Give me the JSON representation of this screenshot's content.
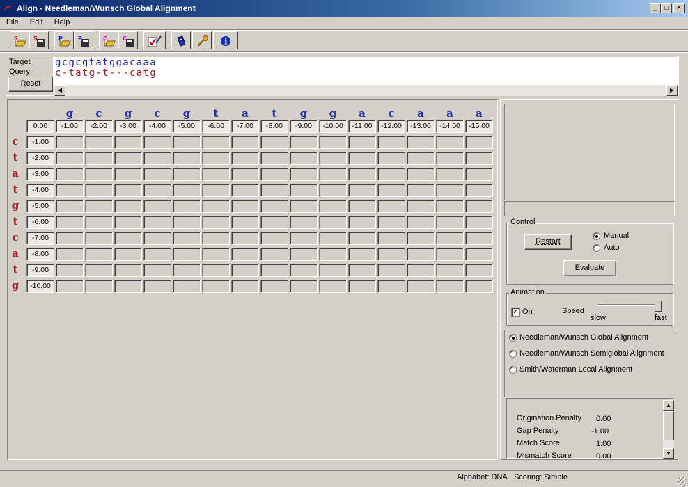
{
  "window": {
    "title": "Align - Needleman/Wunsch Global Alignment"
  },
  "menu": [
    "File",
    "Edit",
    "Help"
  ],
  "toolbar": [
    {
      "name": "open-sequence-s-icon"
    },
    {
      "name": "save-sequence-s-icon"
    },
    {
      "name": "open-project-p-icon"
    },
    {
      "name": "save-project-p-icon"
    },
    {
      "name": "open-config-c-icon"
    },
    {
      "name": "save-config-c-icon"
    },
    {
      "name": "edit-checklist-icon"
    },
    {
      "name": "book-icon"
    },
    {
      "name": "key-icon"
    },
    {
      "name": "info-icon"
    }
  ],
  "sequences": {
    "target_label": "Target",
    "query_label": "Query",
    "reset_label": "Reset",
    "target": "gcgcgtatggacaaa",
    "query": "c-tatg-t---catg"
  },
  "matrix": {
    "col_letters": [
      "g",
      "c",
      "g",
      "c",
      "g",
      "t",
      "a",
      "t",
      "g",
      "g",
      "a",
      "c",
      "a",
      "a",
      "a"
    ],
    "origin": "0.00",
    "col_values": [
      "-1.00",
      "-2.00",
      "-3.00",
      "-4.00",
      "-5.00",
      "-6.00",
      "-7.00",
      "-8.00",
      "-9.00",
      "-10.00",
      "-11.00",
      "-12.00",
      "-13.00",
      "-14.00",
      "-15.00"
    ],
    "row_letters": [
      "c",
      "t",
      "a",
      "t",
      "g",
      "t",
      "c",
      "a",
      "t",
      "g"
    ],
    "row_values": [
      "-1.00",
      "-2.00",
      "-3.00",
      "-4.00",
      "-5.00",
      "-6.00",
      "-7.00",
      "-8.00",
      "-9.00",
      "-10.00"
    ]
  },
  "control": {
    "label": "Control",
    "restart": "Restart",
    "evaluate": "Evaluate",
    "manual": "Manual",
    "auto": "Auto",
    "mode": "Manual"
  },
  "animation": {
    "label": "Animation",
    "on_label": "On",
    "on": true,
    "speed_label": "Speed",
    "slow": "slow",
    "fast": "fast",
    "speed_level": 0.95
  },
  "algorithms": {
    "options": [
      "Needleman/Wunsch Global Alignment",
      "Needleman/Wunsch Semiglobal Alignment",
      "Smith/Waterman Local Alignment"
    ],
    "selected": 0
  },
  "scoring": [
    {
      "label": "Origination Penalty",
      "value": "0.00"
    },
    {
      "label": "Gap Penalty",
      "value": "-1.00"
    },
    {
      "label": "Match Score",
      "value": "1.00"
    },
    {
      "label": "Mismatch Score",
      "value": "0.00"
    }
  ],
  "status": {
    "alphabet": "Alphabet: DNA",
    "scoring": "Scoring: Simple"
  }
}
